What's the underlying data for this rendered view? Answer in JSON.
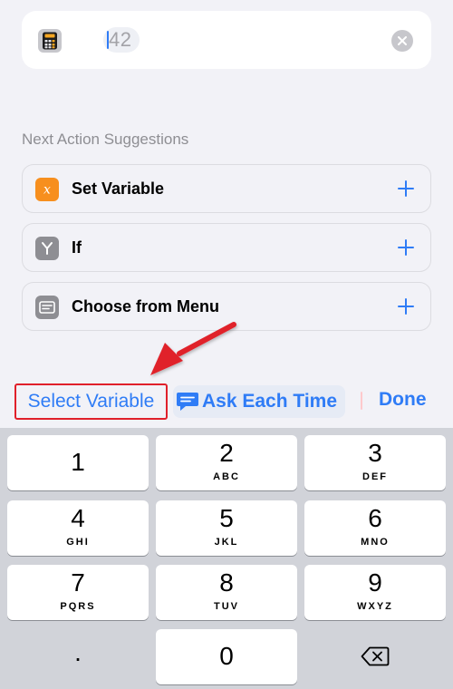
{
  "number_action": {
    "value": "42",
    "icon": "calculator-icon",
    "clear_icon": "clear-icon"
  },
  "suggestions": {
    "title": "Next Action Suggestions",
    "items": [
      {
        "label": "Set Variable",
        "icon": "variable-icon",
        "icon_color": "#f78f1e"
      },
      {
        "label": "If",
        "icon": "branch-icon",
        "icon_color": "#8e8e93"
      },
      {
        "label": "Choose from Menu",
        "icon": "menu-icon",
        "icon_color": "#8e8e93"
      }
    ],
    "add_icon": "plus-icon"
  },
  "accessory_bar": {
    "select_variable": "Select Variable",
    "ask_each_time": "Ask Each Time",
    "done": "Done"
  },
  "keypad": {
    "keys": [
      {
        "digit": "1",
        "letters": ""
      },
      {
        "digit": "2",
        "letters": "ABC"
      },
      {
        "digit": "3",
        "letters": "DEF"
      },
      {
        "digit": "4",
        "letters": "GHI"
      },
      {
        "digit": "5",
        "letters": "JKL"
      },
      {
        "digit": "6",
        "letters": "MNO"
      },
      {
        "digit": "7",
        "letters": "PQRS"
      },
      {
        "digit": "8",
        "letters": "TUV"
      },
      {
        "digit": "9",
        "letters": "WXYZ"
      }
    ],
    "decimal": ".",
    "zero": "0",
    "delete_icon": "backspace-icon"
  },
  "colors": {
    "accent": "#2f7cf6",
    "annotation": "#e0202a",
    "background": "#f2f2f7"
  }
}
